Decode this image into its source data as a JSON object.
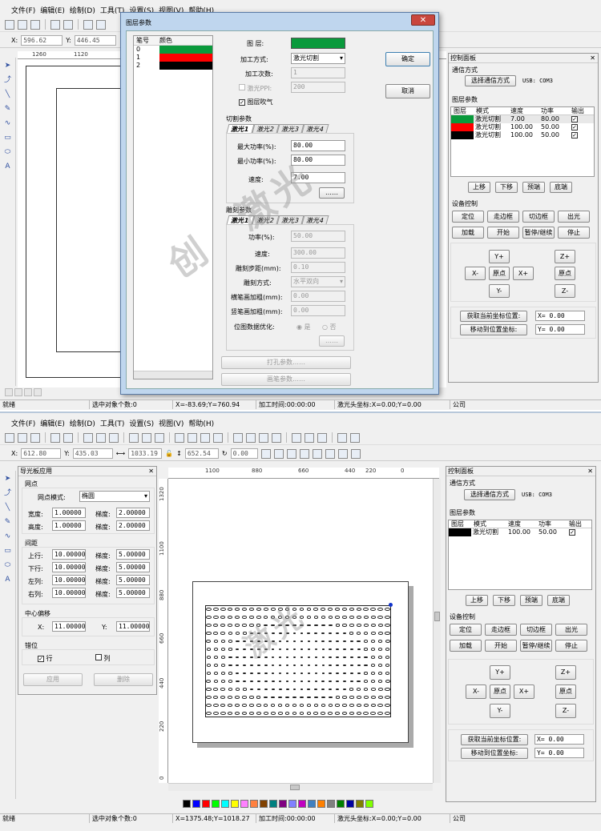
{
  "top": {
    "menu": [
      "文件(F)",
      "编辑(E)",
      "绘制(D)",
      "工具(T)",
      "设置(S)",
      "视图(V)",
      "帮助(H)"
    ],
    "coords": {
      "x_label": "X:",
      "x_value": "596.62",
      "y_label": "Y:",
      "y_value": "446.45"
    },
    "ruler_ticks": [
      "1260",
      "1120"
    ],
    "status": [
      "就绪",
      "选中对象个数:0",
      "X=-83.69;Y=760.94",
      "加工时间:00:00:00",
      "激光头坐标:X=0.00;Y=0.00",
      "公司"
    ]
  },
  "dialog": {
    "title": "图层参数",
    "list_headers": [
      "笔号",
      "颜色"
    ],
    "list_rows": [
      {
        "num": "0",
        "color": "#0a9a3c"
      },
      {
        "num": "1",
        "color": "#ff0000"
      },
      {
        "num": "2",
        "color": "#000000"
      }
    ],
    "layer_label": "图 层:",
    "layer_color": "#0a9a3c",
    "mode_label": "加工方式:",
    "mode_value": "激光切割",
    "count_label": "加工次数:",
    "count_value": "1",
    "ppi_label": "激光PPI:",
    "ppi_value": "200",
    "blow_label": "图层吹气",
    "ok": "确定",
    "cancel": "取消",
    "cut_section": "切割参数",
    "tabs": [
      "激光1",
      "激光2",
      "激光3",
      "激光4"
    ],
    "max_power_label": "最大功率(%):",
    "max_power": "80.00",
    "min_power_label": "最小功率(%):",
    "min_power": "80.00",
    "speed_label": "速度:",
    "speed": "7.00",
    "ellipsis": "……",
    "engrave_section": "雕刻参数",
    "power_label": "功率(%):",
    "power": "50.00",
    "engrave_speed_label": "速度:",
    "engrave_speed": "300.00",
    "step_label": "雕刻步距(mm):",
    "step": "0.10",
    "engrave_mode_label": "雕刻方式:",
    "engrave_mode": "水平双向",
    "h_thick_label": "横笔画加粗(mm):",
    "h_thick": "0.00",
    "v_thick_label": "竖笔画加粗(mm):",
    "v_thick": "0.00",
    "bitmap_label": "位图数据优化:",
    "yes": "是",
    "no": "否",
    "punch_btn": "打孔参数……",
    "brush_btn": "画笔参数……"
  },
  "control_top": {
    "title": "控制面板",
    "comm_section": "通信方式",
    "comm_btn": "选择通信方式",
    "comm_value": "USB: COM3",
    "layer_section": "图层参数",
    "headers": [
      "图层",
      "模式",
      "速度",
      "功率",
      "输出"
    ],
    "rows": [
      {
        "color": "#0a9a3c",
        "mode": "激光切割",
        "speed": "7.00",
        "power": "80.00",
        "out": "✓"
      },
      {
        "color": "#ff0000",
        "mode": "激光切割",
        "speed": "100.00",
        "power": "50.00",
        "out": "✓"
      },
      {
        "color": "#000000",
        "mode": "激光切割",
        "speed": "100.00",
        "power": "50.00",
        "out": "✓"
      }
    ],
    "move_btns": [
      "上移",
      "下移",
      "预端",
      "底端"
    ],
    "device_section": "设备控制",
    "dev_row1": [
      "定位",
      "走边框",
      "切边框",
      "出光"
    ],
    "dev_row2": [
      "加载",
      "开始",
      "暂停/继续",
      "停止"
    ],
    "jog": {
      "yplus": "Y+",
      "xminus": "X-",
      "origin": "原点",
      "xplus": "X+",
      "yminus": "Y-",
      "zplus": "Z+",
      "zorigin": "原点",
      "zminus": "Z-"
    },
    "get_pos": "获取当前坐标位置:",
    "move_pos": "移动到位置坐标:",
    "xval": "X= 0.00",
    "yval": "Y= 0.00"
  },
  "bottom": {
    "menu": [
      "文件(F)",
      "编辑(E)",
      "绘制(D)",
      "工具(T)",
      "设置(S)",
      "视图(V)",
      "帮助(H)"
    ],
    "coords": {
      "x_label": "X:",
      "x_value": "612.80",
      "y_label": "Y:",
      "y_value": "435.03",
      "w_value": "1033.19",
      "h_value": "652.54",
      "angle": "0.00"
    },
    "ruler_ticks": [
      "1100",
      "880",
      "660",
      "440",
      "220",
      "0"
    ],
    "vruler_ticks": [
      "1320",
      "1100",
      "880",
      "660",
      "440",
      "220",
      "0"
    ],
    "status": [
      "就绪",
      "选中对象个数:0",
      "X=1375.48;Y=1018.27",
      "加工时间:00:00:00",
      "激光头坐标:X=0.00;Y=0.00",
      "公司"
    ],
    "palette": [
      "#000000",
      "#0000ff",
      "#ff0000",
      "#00ff00",
      "#00ffff",
      "#ffff00",
      "#ff80ff",
      "#ff8040",
      "#804000",
      "#008080",
      "#800080",
      "#8080ff",
      "#c000c0",
      "#4080c0",
      "#ff8000",
      "#808080",
      "#008000",
      "#0000a0",
      "#808000",
      "#80ff00"
    ]
  },
  "halftone": {
    "title": "导光板应用",
    "dot_section": "网点",
    "dot_mode_label": "网点模式:",
    "dot_mode": "椭圆",
    "width_label": "宽度:",
    "width": "1.00000",
    "width_grad_label": "梯度:",
    "width_grad": "2.00000",
    "height_label": "高度:",
    "height": "1.00000",
    "height_grad_label": "梯度:",
    "height_grad": "2.00000",
    "spacing_section": "间距",
    "spacing": [
      {
        "label": "上行:",
        "value": "10.00000",
        "grad_label": "梯度:",
        "grad": "5.00000"
      },
      {
        "label": "下行:",
        "value": "10.00000",
        "grad_label": "梯度:",
        "grad": "5.00000"
      },
      {
        "label": "左列:",
        "value": "10.00000",
        "grad_label": "梯度:",
        "grad": "5.00000"
      },
      {
        "label": "右列:",
        "value": "10.00000",
        "grad_label": "梯度:",
        "grad": "5.00000"
      }
    ],
    "offset_section": "中心偏移",
    "ox_label": "X:",
    "ox": "11.00000",
    "oy_label": "Y:",
    "oy": "11.00000",
    "stagger_section": "错位",
    "row_label": "行",
    "col_label": "列",
    "apply": "应用",
    "delete": "删除"
  },
  "control_bottom": {
    "title": "控制面板",
    "comm_section": "通信方式",
    "comm_btn": "选择通信方式",
    "comm_value": "USB: COM3",
    "layer_section": "图层参数",
    "headers": [
      "图层",
      "模式",
      "速度",
      "功率",
      "输出"
    ],
    "rows": [
      {
        "color": "#000000",
        "mode": "激光切割",
        "speed": "100.00",
        "power": "50.00",
        "out": "✓"
      }
    ],
    "move_btns": [
      "上移",
      "下移",
      "预端",
      "底端"
    ],
    "device_section": "设备控制",
    "dev_row1": [
      "定位",
      "走边框",
      "切边框",
      "出光"
    ],
    "dev_row2": [
      "加载",
      "开始",
      "暂停/继续",
      "停止"
    ],
    "jog": {
      "yplus": "Y+",
      "xminus": "X-",
      "origin": "原点",
      "xplus": "X+",
      "yminus": "Y-",
      "zplus": "Z+",
      "zorigin": "原点",
      "zminus": "Z-"
    },
    "get_pos": "获取当前坐标位置:",
    "move_pos": "移动到位置坐标:",
    "xval": "X= 0.00",
    "yval": "Y= 0.00"
  }
}
